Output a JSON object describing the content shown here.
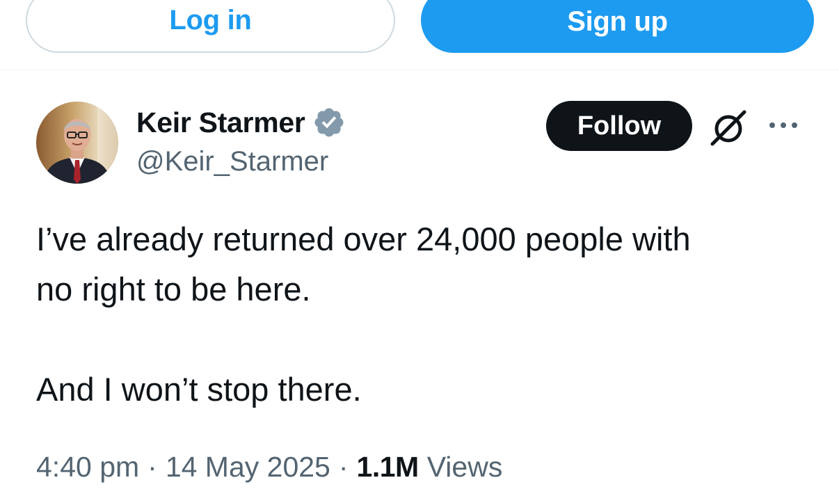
{
  "auth": {
    "login_label": "Log in",
    "signup_label": "Sign up"
  },
  "tweet": {
    "author": {
      "name": "Keir Starmer",
      "handle": "@Keir_Starmer",
      "verified": true,
      "verified_color": "#829aab"
    },
    "follow_label": "Follow",
    "text_lines": [
      "I’ve already returned over 24,000 people with",
      "no right to be here.",
      "And I won’t stop there."
    ],
    "meta": {
      "time": "4:40 pm",
      "separator": "·",
      "date": "14 May 2025",
      "views_count": "1.1M",
      "views_label": "Views"
    }
  },
  "icons": {
    "grok": "grok-icon",
    "more": "more-icon"
  },
  "colors": {
    "accent": "#1d9bf0",
    "text": "#0f1419",
    "secondary": "#536471",
    "border": "#cfd9de"
  }
}
